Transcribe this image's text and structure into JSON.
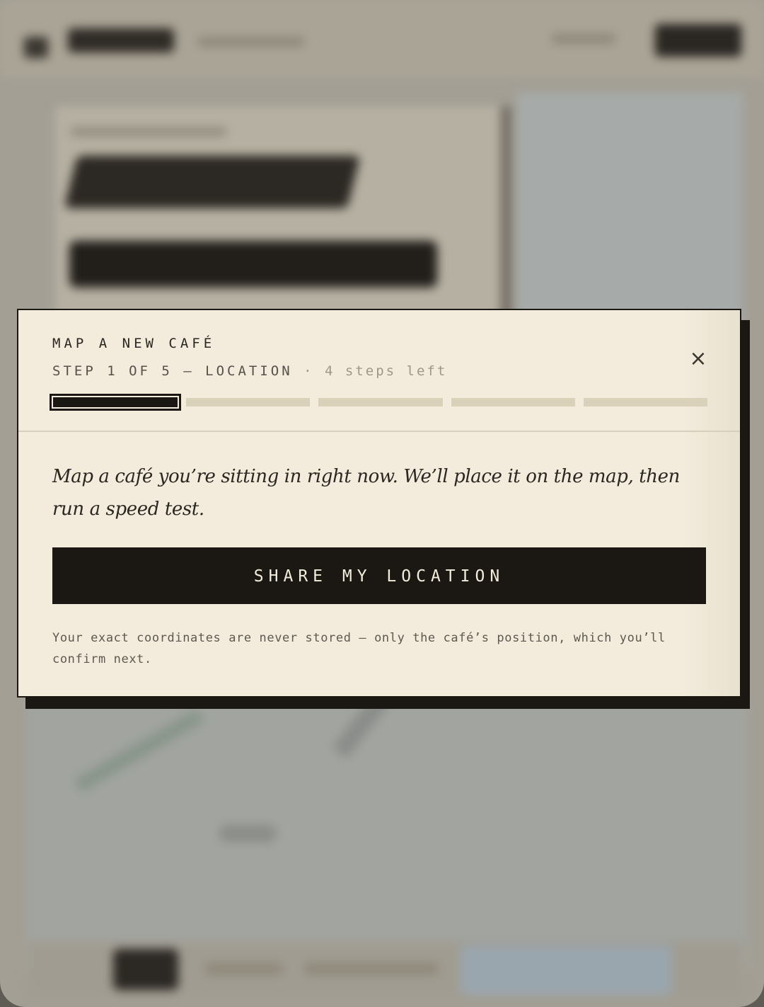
{
  "modal": {
    "eyebrow": "MAP A NEW CAFÉ",
    "step_text": "STEP 1 OF 5 — LOCATION",
    "separator": "·",
    "steps_remaining": "4 steps left",
    "progress": {
      "current_step": 1,
      "total_steps": 5
    },
    "close_symbol": "×",
    "close_icon": "close-icon",
    "lead": "Map a café you’re sitting in right now. We’ll place it on the map, then run a speed test.",
    "primary_button": "SHARE MY LOCATION",
    "privacy_note": "Your exact coordinates are never stored — only the café’s position, which you’ll confirm next."
  },
  "colors": {
    "ink": "#1b1814",
    "paper": "#f3ecdc",
    "progress_inactive": "#d9d1ba"
  }
}
